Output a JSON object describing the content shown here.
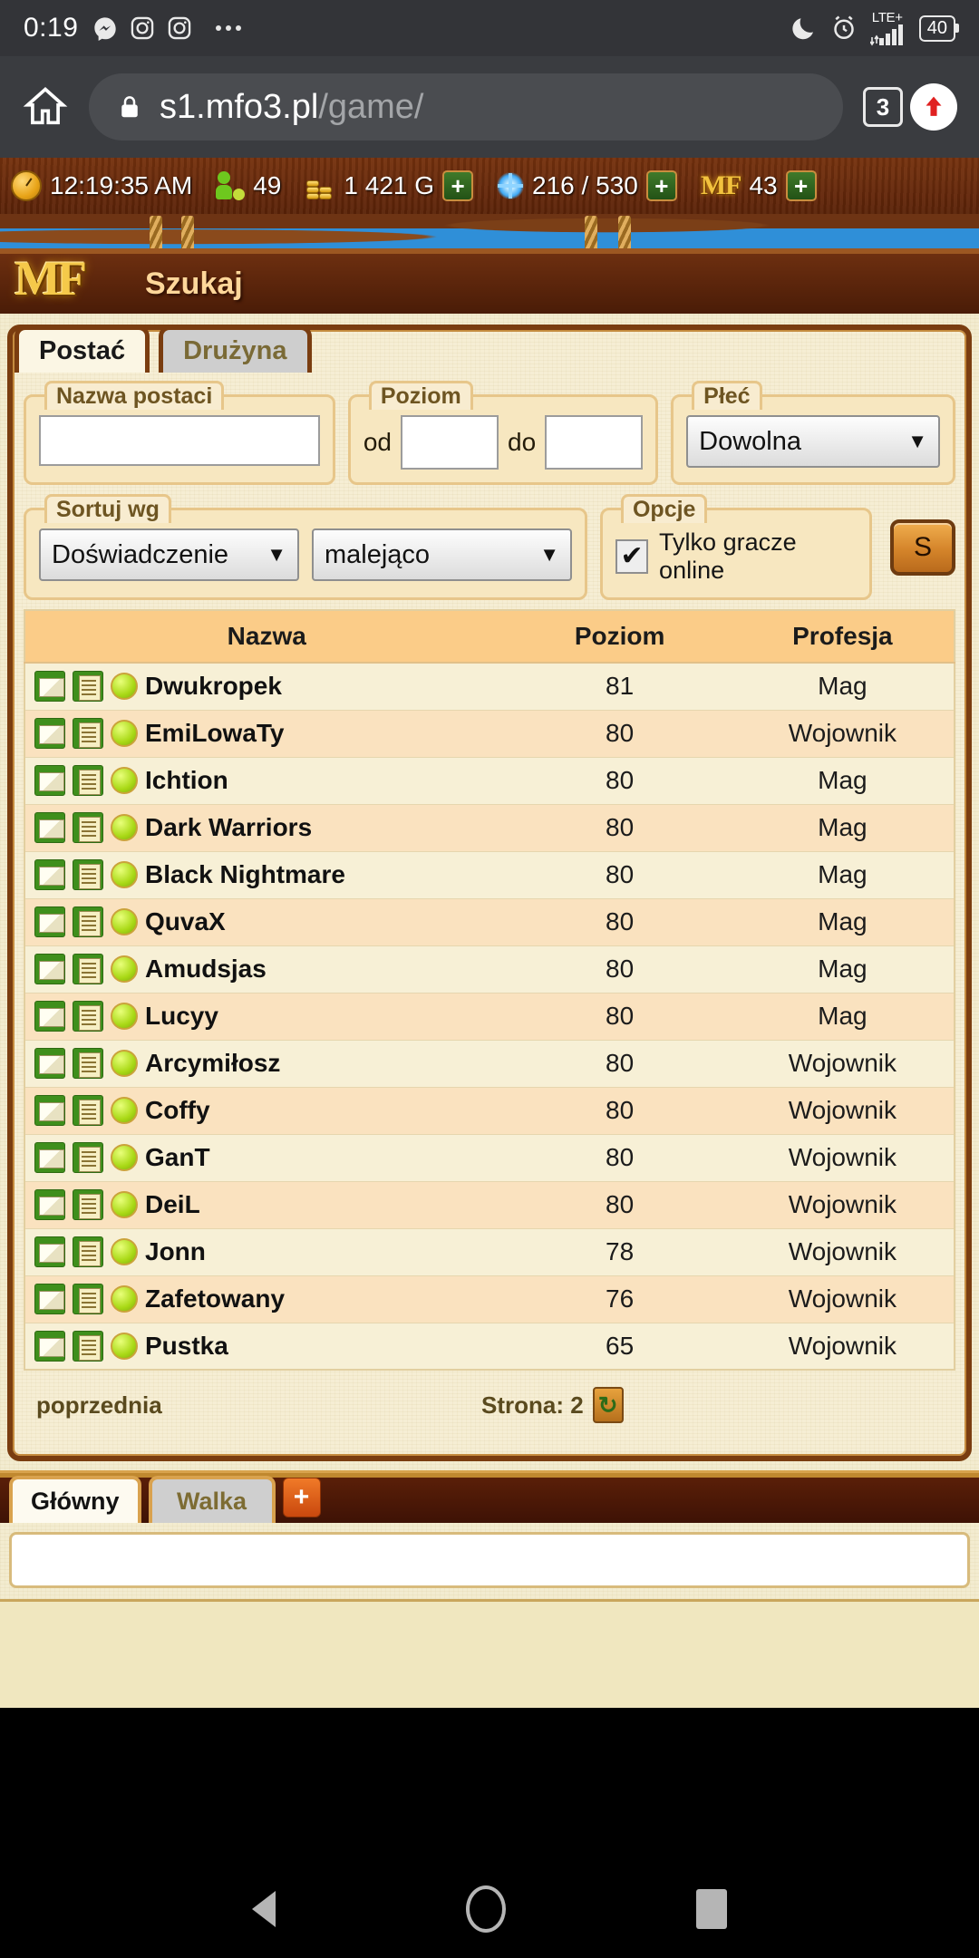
{
  "status_bar": {
    "time": "0:19",
    "icons": [
      "messenger-icon",
      "instagram-icon",
      "instagram-icon"
    ],
    "overflow": "more-notifications-icon",
    "dnd": "moon-icon",
    "alarm": "alarm-icon",
    "network_label": "LTE+",
    "battery_level": "40"
  },
  "browser": {
    "home_icon": "home-icon",
    "lock_icon": "lock-icon",
    "url_host": "s1.mfo3.pl",
    "url_path": "/game/",
    "tab_count": "3",
    "menu_icon": "upload-arrow-icon"
  },
  "resource_bar": {
    "clock": "12:19:35 AM",
    "players_online": "49",
    "gold": "1 421 G",
    "energy": "216 / 530",
    "mf_label": "MF",
    "mf_value": "43",
    "plus_label": "+"
  },
  "banner": {
    "logo": "MF",
    "title": "Szukaj"
  },
  "tabs": [
    {
      "label": "Postać",
      "active": true
    },
    {
      "label": "Drużyna",
      "active": false
    }
  ],
  "search_form": {
    "name_legend": "Nazwa postaci",
    "name_value": "",
    "level_legend": "Poziom",
    "level_from_label": "od",
    "level_from_value": "",
    "level_to_label": "do",
    "level_to_value": "",
    "sex_legend": "Płeć",
    "sex_value": "Dowolna",
    "sort_legend": "Sortuj wg",
    "sort_by_value": "Doświadczenie",
    "sort_dir_value": "malejąco",
    "options_legend": "Opcje",
    "online_only_label": "Tylko gracze online",
    "online_only_checked": "✔",
    "submit_label": "S",
    "caret": "▼"
  },
  "results": {
    "columns": [
      "Nazwa",
      "Poziom",
      "Profesja"
    ],
    "rows": [
      {
        "name": "Dwukropek",
        "level": "81",
        "profession": "Mag"
      },
      {
        "name": "EmiLowaTy",
        "level": "80",
        "profession": "Wojownik"
      },
      {
        "name": "Ichtion",
        "level": "80",
        "profession": "Mag"
      },
      {
        "name": "Dark Warriors",
        "level": "80",
        "profession": "Mag"
      },
      {
        "name": "Black Nightmare",
        "level": "80",
        "profession": "Mag"
      },
      {
        "name": "QuvaX",
        "level": "80",
        "profession": "Mag"
      },
      {
        "name": "Amudsjas",
        "level": "80",
        "profession": "Mag"
      },
      {
        "name": "Lucyy",
        "level": "80",
        "profession": "Mag"
      },
      {
        "name": "Arcymiłosz",
        "level": "80",
        "profession": "Wojownik"
      },
      {
        "name": "Coffy",
        "level": "80",
        "profession": "Wojownik"
      },
      {
        "name": "GanT",
        "level": "80",
        "profession": "Wojownik"
      },
      {
        "name": "DeiL",
        "level": "80",
        "profession": "Wojownik"
      },
      {
        "name": "Jonn",
        "level": "78",
        "profession": "Wojownik"
      },
      {
        "name": "Zafetowany",
        "level": "76",
        "profession": "Wojownik"
      },
      {
        "name": "Pustka",
        "level": "65",
        "profession": "Wojownik"
      }
    ]
  },
  "pager": {
    "prev_label": "poprzednia",
    "page_label": "Strona: 2",
    "refresh_icon": "↻"
  },
  "chat": {
    "tabs": [
      {
        "label": "Główny",
        "active": true
      },
      {
        "label": "Walka",
        "active": false
      }
    ],
    "add_tab_label": "+",
    "input_value": ""
  }
}
